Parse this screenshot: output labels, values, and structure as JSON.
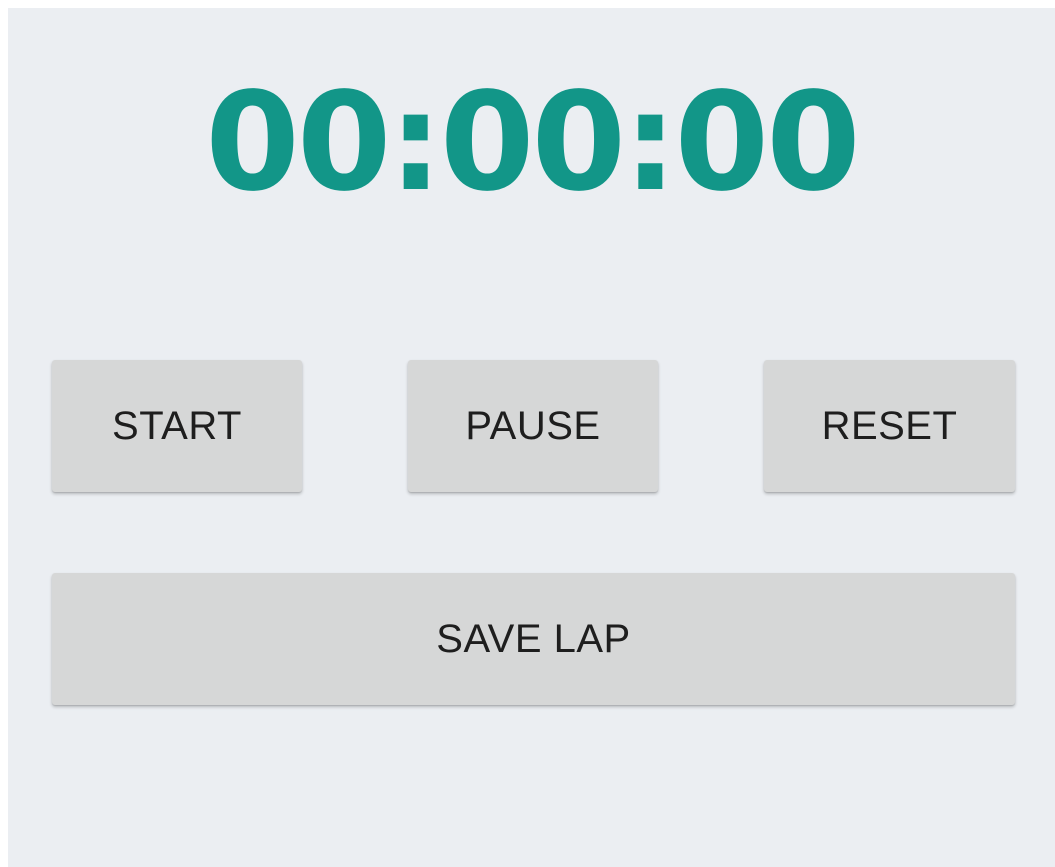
{
  "stopwatch": {
    "time_display": "00:00:00"
  },
  "controls": {
    "start_label": "START",
    "pause_label": "PAUSE",
    "reset_label": "RESET",
    "save_lap_label": "SAVE LAP"
  },
  "colors": {
    "timer_text": "#129688",
    "background": "#ebeef2",
    "button_background": "#d6d7d7",
    "button_text": "#1e1e1e"
  }
}
